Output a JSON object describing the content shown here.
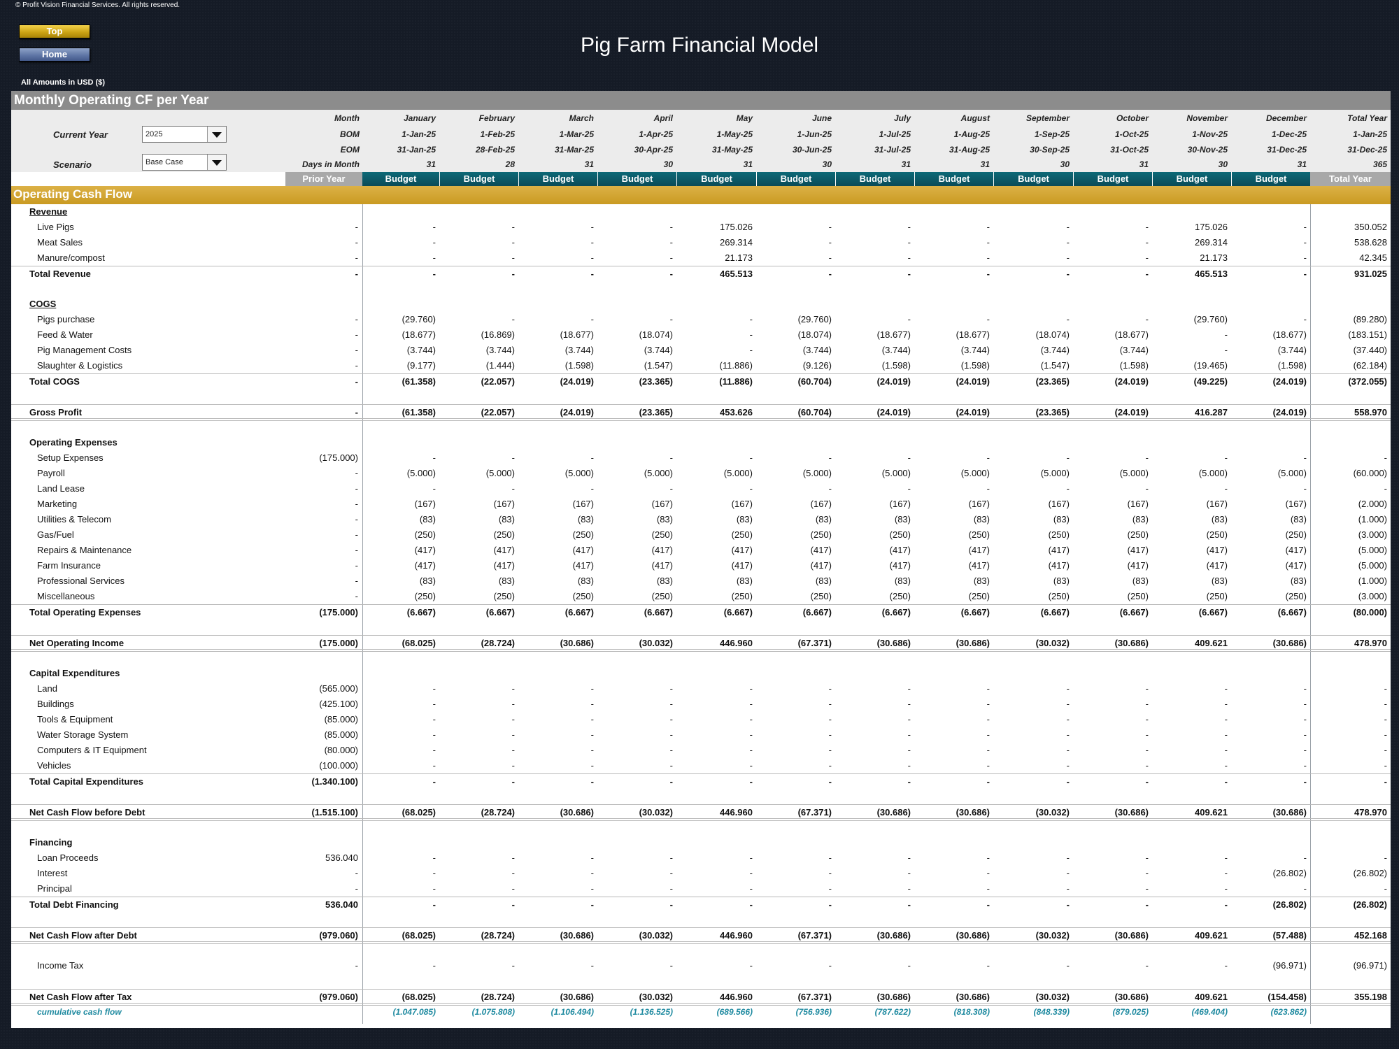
{
  "copyright": "© Profit Vision Financial Services. All rights reserved.",
  "nav": {
    "top": "Top",
    "home": "Home"
  },
  "title": "Pig Farm Financial Model",
  "amounts_note": "All Amounts in  USD ($)",
  "section_title": "Monthly Operating CF per Year",
  "controls": {
    "current_year_label": "Current Year",
    "current_year_value": "2025",
    "scenario_label": "Scenario",
    "scenario_value": "Base Case"
  },
  "header_labels": {
    "month": "Month",
    "bom": "BOM",
    "eom": "EOM",
    "days": "Days in Month"
  },
  "months": [
    {
      "name": "January",
      "bom": "1-Jan-25",
      "eom": "31-Jan-25",
      "days": "31"
    },
    {
      "name": "February",
      "bom": "1-Feb-25",
      "eom": "28-Feb-25",
      "days": "28"
    },
    {
      "name": "March",
      "bom": "1-Mar-25",
      "eom": "31-Mar-25",
      "days": "31"
    },
    {
      "name": "April",
      "bom": "1-Apr-25",
      "eom": "30-Apr-25",
      "days": "30"
    },
    {
      "name": "May",
      "bom": "1-May-25",
      "eom": "31-May-25",
      "days": "31"
    },
    {
      "name": "June",
      "bom": "1-Jun-25",
      "eom": "30-Jun-25",
      "days": "30"
    },
    {
      "name": "July",
      "bom": "1-Jul-25",
      "eom": "31-Jul-25",
      "days": "31"
    },
    {
      "name": "August",
      "bom": "1-Aug-25",
      "eom": "31-Aug-25",
      "days": "31"
    },
    {
      "name": "September",
      "bom": "1-Sep-25",
      "eom": "30-Sep-25",
      "days": "30"
    },
    {
      "name": "October",
      "bom": "1-Oct-25",
      "eom": "31-Oct-25",
      "days": "31"
    },
    {
      "name": "November",
      "bom": "1-Nov-25",
      "eom": "30-Nov-25",
      "days": "30"
    },
    {
      "name": "December",
      "bom": "1-Dec-25",
      "eom": "31-Dec-25",
      "days": "31"
    },
    {
      "name": "Total Year",
      "bom": "1-Jan-25",
      "eom": "31-Dec-25",
      "days": "365"
    }
  ],
  "band": {
    "prior": "Prior Year",
    "budget": "Budget",
    "total": "Total Year"
  },
  "ocf_title": "Operating Cash Flow",
  "rows": [
    {
      "label": "Revenue",
      "style": "section-u",
      "values": []
    },
    {
      "label": "Live Pigs",
      "style": "item",
      "values": [
        "-",
        "-",
        "-",
        "-",
        "-",
        "175.026",
        "-",
        "-",
        "-",
        "-",
        "-",
        "175.026",
        "-",
        "350.052"
      ]
    },
    {
      "label": "Meat Sales",
      "style": "item",
      "values": [
        "-",
        "-",
        "-",
        "-",
        "-",
        "269.314",
        "-",
        "-",
        "-",
        "-",
        "-",
        "269.314",
        "-",
        "538.628"
      ]
    },
    {
      "label": "Manure/compost",
      "style": "item",
      "values": [
        "-",
        "-",
        "-",
        "-",
        "-",
        "21.173",
        "-",
        "-",
        "-",
        "-",
        "-",
        "21.173",
        "-",
        "42.345"
      ]
    },
    {
      "label": "Total Revenue",
      "style": "total",
      "values": [
        "-",
        "-",
        "-",
        "-",
        "-",
        "465.513",
        "-",
        "-",
        "-",
        "-",
        "-",
        "465.513",
        "-",
        "931.025"
      ]
    },
    {
      "label": "",
      "style": "blank",
      "values": []
    },
    {
      "label": "COGS",
      "style": "section-u",
      "values": []
    },
    {
      "label": "Pigs purchase",
      "style": "item",
      "values": [
        "-",
        "(29.760)",
        "-",
        "-",
        "-",
        "-",
        "(29.760)",
        "-",
        "-",
        "-",
        "-",
        "(29.760)",
        "-",
        "(89.280)"
      ]
    },
    {
      "label": "Feed & Water",
      "style": "item",
      "values": [
        "-",
        "(18.677)",
        "(16.869)",
        "(18.677)",
        "(18.074)",
        "-",
        "(18.074)",
        "(18.677)",
        "(18.677)",
        "(18.074)",
        "(18.677)",
        "-",
        "(18.677)",
        "(183.151)"
      ]
    },
    {
      "label": "Pig Management Costs",
      "style": "item",
      "values": [
        "-",
        "(3.744)",
        "(3.744)",
        "(3.744)",
        "(3.744)",
        "-",
        "(3.744)",
        "(3.744)",
        "(3.744)",
        "(3.744)",
        "(3.744)",
        "-",
        "(3.744)",
        "(37.440)"
      ]
    },
    {
      "label": "Slaughter & Logistics",
      "style": "item",
      "values": [
        "-",
        "(9.177)",
        "(1.444)",
        "(1.598)",
        "(1.547)",
        "(11.886)",
        "(9.126)",
        "(1.598)",
        "(1.598)",
        "(1.547)",
        "(1.598)",
        "(19.465)",
        "(1.598)",
        "(62.184)"
      ]
    },
    {
      "label": "Total COGS",
      "style": "total",
      "values": [
        "-",
        "(61.358)",
        "(22.057)",
        "(24.019)",
        "(23.365)",
        "(11.886)",
        "(60.704)",
        "(24.019)",
        "(24.019)",
        "(23.365)",
        "(24.019)",
        "(49.225)",
        "(24.019)",
        "(372.055)"
      ]
    },
    {
      "label": "",
      "style": "blank",
      "values": []
    },
    {
      "label": "Gross Profit",
      "style": "grand",
      "values": [
        "-",
        "(61.358)",
        "(22.057)",
        "(24.019)",
        "(23.365)",
        "453.626",
        "(60.704)",
        "(24.019)",
        "(24.019)",
        "(23.365)",
        "(24.019)",
        "416.287",
        "(24.019)",
        "558.970"
      ]
    },
    {
      "label": "",
      "style": "blank",
      "values": []
    },
    {
      "label": "Operating Expenses",
      "style": "section",
      "values": []
    },
    {
      "label": "Setup Expenses",
      "style": "item",
      "values": [
        "(175.000)",
        "-",
        "-",
        "-",
        "-",
        "-",
        "-",
        "-",
        "-",
        "-",
        "-",
        "-",
        "-",
        "-"
      ]
    },
    {
      "label": "Payroll",
      "style": "item",
      "values": [
        "-",
        "(5.000)",
        "(5.000)",
        "(5.000)",
        "(5.000)",
        "(5.000)",
        "(5.000)",
        "(5.000)",
        "(5.000)",
        "(5.000)",
        "(5.000)",
        "(5.000)",
        "(5.000)",
        "(60.000)"
      ]
    },
    {
      "label": "Land Lease",
      "style": "item",
      "values": [
        "-",
        "-",
        "-",
        "-",
        "-",
        "-",
        "-",
        "-",
        "-",
        "-",
        "-",
        "-",
        "-",
        "-"
      ]
    },
    {
      "label": "Marketing",
      "style": "item",
      "values": [
        "-",
        "(167)",
        "(167)",
        "(167)",
        "(167)",
        "(167)",
        "(167)",
        "(167)",
        "(167)",
        "(167)",
        "(167)",
        "(167)",
        "(167)",
        "(2.000)"
      ]
    },
    {
      "label": "Utilities & Telecom",
      "style": "item",
      "values": [
        "-",
        "(83)",
        "(83)",
        "(83)",
        "(83)",
        "(83)",
        "(83)",
        "(83)",
        "(83)",
        "(83)",
        "(83)",
        "(83)",
        "(83)",
        "(1.000)"
      ]
    },
    {
      "label": "Gas/Fuel",
      "style": "item",
      "values": [
        "-",
        "(250)",
        "(250)",
        "(250)",
        "(250)",
        "(250)",
        "(250)",
        "(250)",
        "(250)",
        "(250)",
        "(250)",
        "(250)",
        "(250)",
        "(3.000)"
      ]
    },
    {
      "label": "Repairs & Maintenance",
      "style": "item",
      "values": [
        "-",
        "(417)",
        "(417)",
        "(417)",
        "(417)",
        "(417)",
        "(417)",
        "(417)",
        "(417)",
        "(417)",
        "(417)",
        "(417)",
        "(417)",
        "(5.000)"
      ]
    },
    {
      "label": "Farm Insurance",
      "style": "item",
      "values": [
        "-",
        "(417)",
        "(417)",
        "(417)",
        "(417)",
        "(417)",
        "(417)",
        "(417)",
        "(417)",
        "(417)",
        "(417)",
        "(417)",
        "(417)",
        "(5.000)"
      ]
    },
    {
      "label": "Professional Services",
      "style": "item",
      "values": [
        "-",
        "(83)",
        "(83)",
        "(83)",
        "(83)",
        "(83)",
        "(83)",
        "(83)",
        "(83)",
        "(83)",
        "(83)",
        "(83)",
        "(83)",
        "(1.000)"
      ]
    },
    {
      "label": "Miscellaneous",
      "style": "item",
      "values": [
        "-",
        "(250)",
        "(250)",
        "(250)",
        "(250)",
        "(250)",
        "(250)",
        "(250)",
        "(250)",
        "(250)",
        "(250)",
        "(250)",
        "(250)",
        "(3.000)"
      ]
    },
    {
      "label": "Total Operating Expenses",
      "style": "total",
      "values": [
        "(175.000)",
        "(6.667)",
        "(6.667)",
        "(6.667)",
        "(6.667)",
        "(6.667)",
        "(6.667)",
        "(6.667)",
        "(6.667)",
        "(6.667)",
        "(6.667)",
        "(6.667)",
        "(6.667)",
        "(80.000)"
      ]
    },
    {
      "label": "",
      "style": "blank",
      "values": []
    },
    {
      "label": "Net Operating Income",
      "style": "grand",
      "values": [
        "(175.000)",
        "(68.025)",
        "(28.724)",
        "(30.686)",
        "(30.032)",
        "446.960",
        "(67.371)",
        "(30.686)",
        "(30.686)",
        "(30.032)",
        "(30.686)",
        "409.621",
        "(30.686)",
        "478.970"
      ]
    },
    {
      "label": "",
      "style": "blank",
      "values": []
    },
    {
      "label": "Capital Expenditures",
      "style": "section",
      "values": []
    },
    {
      "label": "Land",
      "style": "item",
      "values": [
        "(565.000)",
        "-",
        "-",
        "-",
        "-",
        "-",
        "-",
        "-",
        "-",
        "-",
        "-",
        "-",
        "-",
        "-"
      ]
    },
    {
      "label": "Buildings",
      "style": "item",
      "values": [
        "(425.100)",
        "-",
        "-",
        "-",
        "-",
        "-",
        "-",
        "-",
        "-",
        "-",
        "-",
        "-",
        "-",
        "-"
      ]
    },
    {
      "label": "Tools & Equipment",
      "style": "item",
      "values": [
        "(85.000)",
        "-",
        "-",
        "-",
        "-",
        "-",
        "-",
        "-",
        "-",
        "-",
        "-",
        "-",
        "-",
        "-"
      ]
    },
    {
      "label": "Water Storage System",
      "style": "item",
      "values": [
        "(85.000)",
        "-",
        "-",
        "-",
        "-",
        "-",
        "-",
        "-",
        "-",
        "-",
        "-",
        "-",
        "-",
        "-"
      ]
    },
    {
      "label": "Computers & IT Equipment",
      "style": "item",
      "values": [
        "(80.000)",
        "-",
        "-",
        "-",
        "-",
        "-",
        "-",
        "-",
        "-",
        "-",
        "-",
        "-",
        "-",
        "-"
      ]
    },
    {
      "label": "Vehicles",
      "style": "item",
      "values": [
        "(100.000)",
        "-",
        "-",
        "-",
        "-",
        "-",
        "-",
        "-",
        "-",
        "-",
        "-",
        "-",
        "-",
        "-"
      ]
    },
    {
      "label": "Total Capital Expenditures",
      "style": "total",
      "values": [
        "(1.340.100)",
        "-",
        "-",
        "-",
        "-",
        "-",
        "-",
        "-",
        "-",
        "-",
        "-",
        "-",
        "-",
        "-"
      ]
    },
    {
      "label": "",
      "style": "blank",
      "values": []
    },
    {
      "label": "Net Cash Flow before Debt",
      "style": "grand",
      "values": [
        "(1.515.100)",
        "(68.025)",
        "(28.724)",
        "(30.686)",
        "(30.032)",
        "446.960",
        "(67.371)",
        "(30.686)",
        "(30.686)",
        "(30.032)",
        "(30.686)",
        "409.621",
        "(30.686)",
        "478.970"
      ]
    },
    {
      "label": "",
      "style": "blank",
      "values": []
    },
    {
      "label": "Financing",
      "style": "section",
      "values": []
    },
    {
      "label": "Loan Proceeds",
      "style": "item",
      "values": [
        "536.040",
        "-",
        "-",
        "-",
        "-",
        "-",
        "-",
        "-",
        "-",
        "-",
        "-",
        "-",
        "-",
        "-"
      ]
    },
    {
      "label": "Interest",
      "style": "item",
      "values": [
        "-",
        "-",
        "-",
        "-",
        "-",
        "-",
        "-",
        "-",
        "-",
        "-",
        "-",
        "-",
        "(26.802)",
        "(26.802)"
      ]
    },
    {
      "label": "Principal",
      "style": "item",
      "values": [
        "-",
        "-",
        "-",
        "-",
        "-",
        "-",
        "-",
        "-",
        "-",
        "-",
        "-",
        "-",
        "-",
        "-"
      ]
    },
    {
      "label": "Total Debt Financing",
      "style": "total",
      "values": [
        "536.040",
        "-",
        "-",
        "-",
        "-",
        "-",
        "-",
        "-",
        "-",
        "-",
        "-",
        "-",
        "(26.802)",
        "(26.802)"
      ]
    },
    {
      "label": "",
      "style": "blank",
      "values": []
    },
    {
      "label": "Net Cash Flow after Debt",
      "style": "grand",
      "values": [
        "(979.060)",
        "(68.025)",
        "(28.724)",
        "(30.686)",
        "(30.032)",
        "446.960",
        "(67.371)",
        "(30.686)",
        "(30.686)",
        "(30.032)",
        "(30.686)",
        "409.621",
        "(57.488)",
        "452.168"
      ]
    },
    {
      "label": "",
      "style": "blank",
      "values": []
    },
    {
      "label": "Income Tax",
      "style": "item",
      "values": [
        "-",
        "-",
        "-",
        "-",
        "-",
        "-",
        "-",
        "-",
        "-",
        "-",
        "-",
        "-",
        "(96.971)",
        "(96.971)"
      ]
    },
    {
      "label": "",
      "style": "blank",
      "values": []
    },
    {
      "label": "Net Cash Flow after Tax",
      "style": "grand",
      "values": [
        "(979.060)",
        "(68.025)",
        "(28.724)",
        "(30.686)",
        "(30.032)",
        "446.960",
        "(67.371)",
        "(30.686)",
        "(30.686)",
        "(30.032)",
        "(30.686)",
        "409.621",
        "(154.458)",
        "355.198"
      ]
    },
    {
      "label": "cumulative cash flow",
      "style": "cum",
      "values": [
        "",
        "(1.047.085)",
        "(1.075.808)",
        "(1.106.494)",
        "(1.136.525)",
        "(689.566)",
        "(756.936)",
        "(787.622)",
        "(818.308)",
        "(848.339)",
        "(879.025)",
        "(469.404)",
        "(623.862)",
        ""
      ]
    }
  ]
}
